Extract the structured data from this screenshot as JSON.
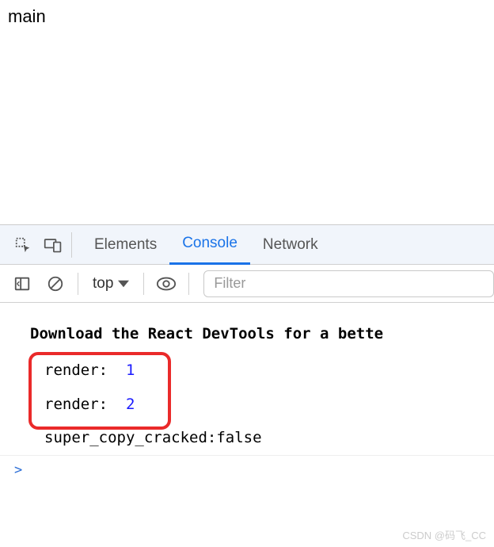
{
  "page": {
    "content_text": "main"
  },
  "devtools": {
    "tabs": {
      "elements": "Elements",
      "console": "Console",
      "network": "Network",
      "active": "console"
    },
    "toolbar": {
      "context": "top",
      "filter_placeholder": "Filter"
    },
    "console": {
      "devtools_msg": "Download the React DevTools for a bette",
      "logs": [
        {
          "label": "render:",
          "value": 1
        },
        {
          "label": "render:",
          "value": 2
        }
      ],
      "extra_log": "super_copy_cracked:false",
      "prompt": ">"
    }
  },
  "watermark": "CSDN @码飞_CC",
  "icons": {
    "inspect": "inspect-icon",
    "device": "device-toolbar-icon",
    "sidebar": "sidebar-toggle-icon",
    "clear": "clear-console-icon",
    "eye": "live-expression-icon",
    "dropdown": "chevron-down-icon"
  }
}
